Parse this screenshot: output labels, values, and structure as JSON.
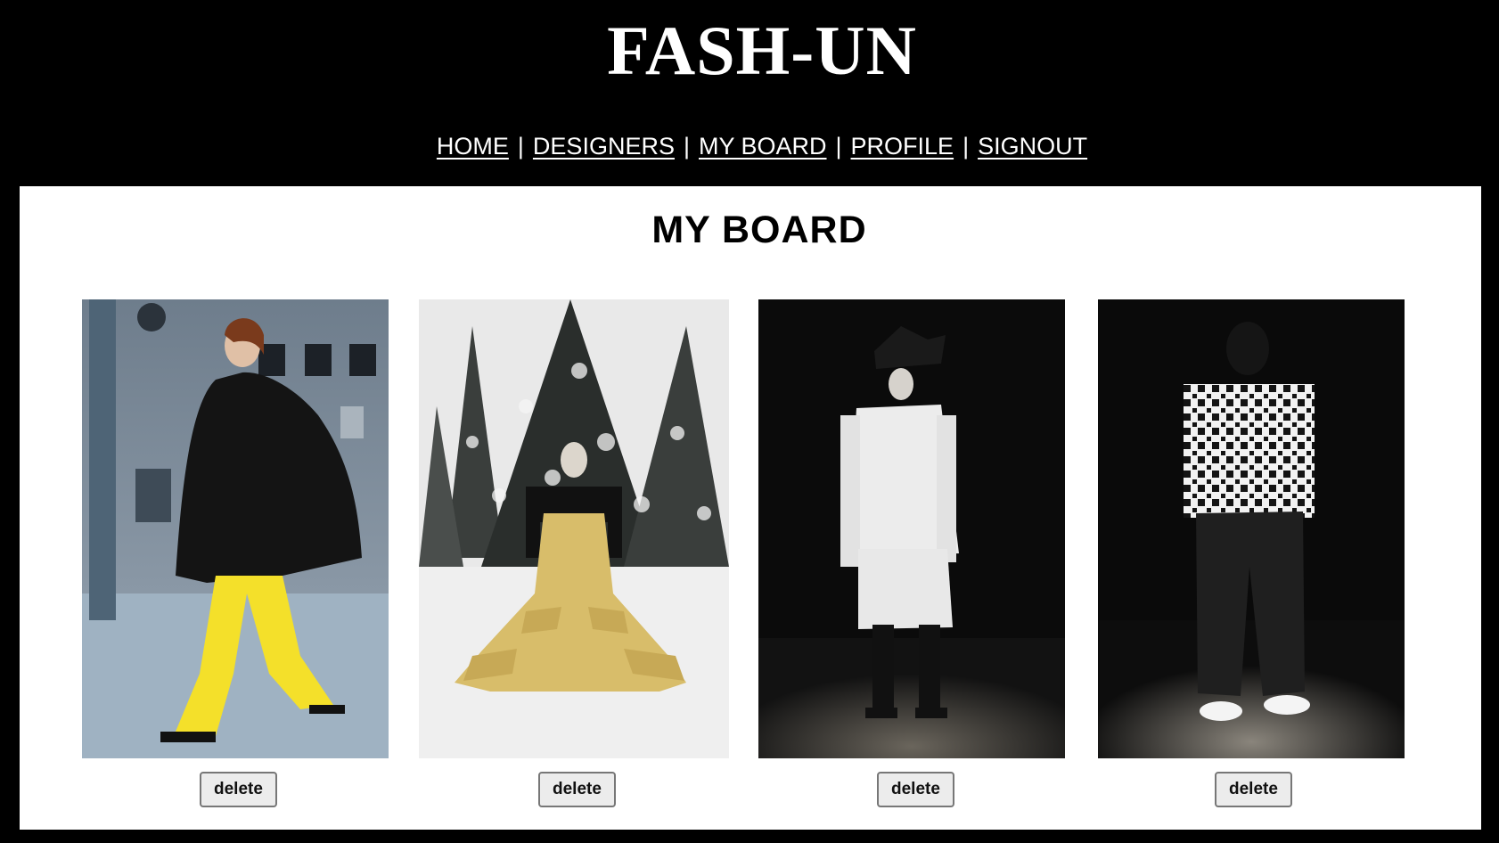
{
  "brand": "FASH-UN",
  "nav": {
    "home": "HOME",
    "designers": "DESIGNERS",
    "my_board": "MY BOARD",
    "profile": "PROFILE",
    "signout": "SIGNOUT",
    "separator": "|"
  },
  "board": {
    "title": "MY BOARD",
    "items": [
      {
        "delete_label": "delete"
      },
      {
        "delete_label": "delete"
      },
      {
        "delete_label": "delete"
      },
      {
        "delete_label": "delete"
      }
    ]
  }
}
